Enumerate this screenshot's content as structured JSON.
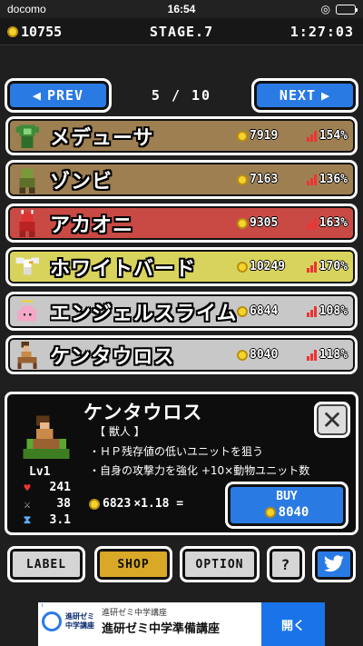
{
  "status": {
    "carrier": "docomo",
    "time": "16:54",
    "battery_level": 0.9
  },
  "hud": {
    "gold": "10755",
    "stage": "STAGE.7",
    "timer": "1:27:03"
  },
  "nav": {
    "prev_label": "PREV",
    "next_label": "NEXT",
    "page": "5 / 10"
  },
  "monsters": [
    {
      "name": "メデューサ",
      "cost": "7919",
      "rate": "154%",
      "color": "#9e7f52",
      "icon": "medusa-sprite"
    },
    {
      "name": "ゾンビ",
      "cost": "7163",
      "rate": "136%",
      "color": "#9e7f52",
      "icon": "zombie-sprite"
    },
    {
      "name": "アカオニ",
      "cost": "9305",
      "rate": "163%",
      "color": "#c94a45",
      "icon": "red-oni-sprite"
    },
    {
      "name": "ホワイトバード",
      "cost": "10249",
      "rate": "170%",
      "color": "#d8d35c",
      "icon": "white-bird-sprite"
    },
    {
      "name": "エンジェルスライム",
      "cost": "6844",
      "rate": "108%",
      "color": "#c8c8c8",
      "icon": "angel-slime-sprite"
    },
    {
      "name": "ケンタウロス",
      "cost": "8040",
      "rate": "118%",
      "color": "#c8c8c8",
      "icon": "centaur-sprite"
    }
  ],
  "detail": {
    "name": "ケンタウロス",
    "type": "【 獣人 】",
    "desc1": "・ＨＰ残存値の低いユニットを狙う",
    "desc2": "・自身の攻撃力を強化 +10×動物ユニット数",
    "level": "Lv1",
    "hp": "241",
    "attack": "38",
    "speed": "3.1",
    "base_cost": "6823",
    "multiplier": "×1.18 =",
    "buy_label": "BUY",
    "buy_price": "8040",
    "close_label": "✕"
  },
  "buttons": {
    "label": "LABEL",
    "shop": "SHOP",
    "option": "OPTION",
    "help": "?"
  },
  "ad": {
    "brand": "進研ゼミ 中学講座",
    "small": "進研ゼミ中学講座",
    "big": "進研ゼミ中学準備講座",
    "open": "開く",
    "info": "i"
  }
}
